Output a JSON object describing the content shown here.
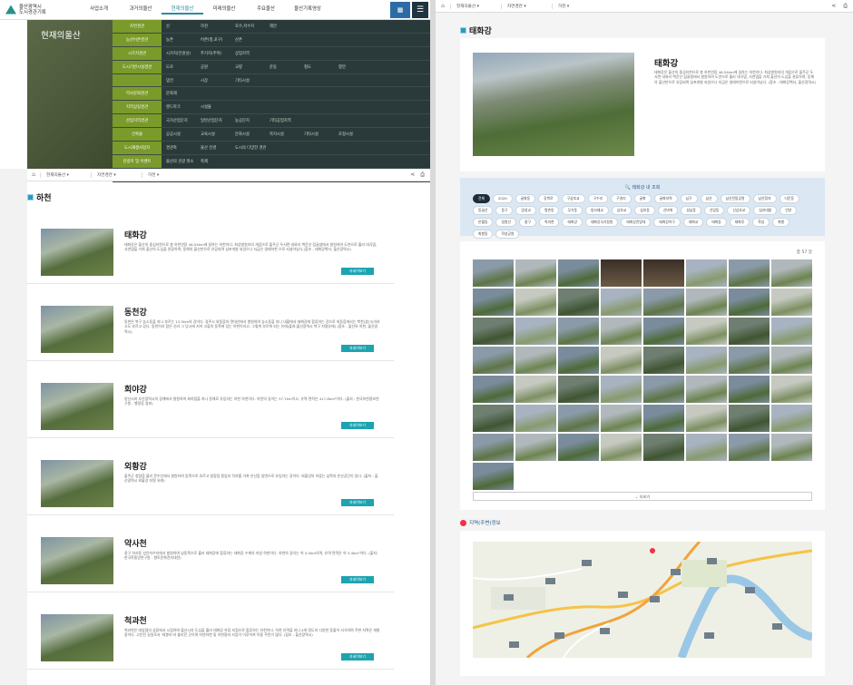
{
  "logo": {
    "line1": "울산광역시",
    "line2": "도시경관기록"
  },
  "nav": [
    "사업소개",
    "과거의울산",
    "현재의울산",
    "미래의울산",
    "주요울산",
    "울산기록영상"
  ],
  "nav_active": "현재의울산",
  "header_button": "meta icon",
  "mega": {
    "brand": "현재의울산",
    "rows": [
      {
        "cat": "자연경관",
        "items": [
          "산",
          "하천",
          "호수,저수지",
          "해안"
        ]
      },
      {
        "cat": "농산어촌경관",
        "items": [
          "농촌",
          "어촌(항,포구)",
          "산촌"
        ]
      },
      {
        "cat": "시가지경관",
        "items": [
          "시가지(전원성)",
          "주거지(주택)",
          "상업지역"
        ]
      },
      {
        "cat": "도시기반시설경관",
        "items": [
          "도로",
          "공원",
          "교량",
          "운동",
          "철도",
          "항만"
        ]
      },
      {
        "cat": "",
        "items": [
          "댐전",
          "시장",
          "기타시설"
        ]
      },
      {
        "cat": "역사문화경관",
        "items": [
          "문화재"
        ]
      },
      {
        "cat": "지역상징경관",
        "items": [
          "랜드마크",
          "시설물"
        ]
      },
      {
        "cat": "산업지역경관",
        "items": [
          "국가산업단지",
          "일반산업단지",
          "농공단지",
          "기타공업지역"
        ]
      },
      {
        "cat": "건축물",
        "items": [
          "공공시설",
          "교육시설",
          "문화시설",
          "복지시설",
          "기타시설",
          "조형시설"
        ]
      },
      {
        "cat": "도시재생사업지",
        "items": [
          "경관축",
          "울산 전경",
          "도시의 다양한 경관"
        ]
      },
      {
        "cat": "관광지 및 이벤트",
        "items": [
          "울산의 관광 명소",
          "축제"
        ]
      },
      {
        "cat": "라이프 변화",
        "items": [
          "사계절의 변화",
          "일출",
          "일몰",
          "동화",
          "야경"
        ]
      }
    ]
  },
  "breadcrumb": [
    "현재의울산",
    "자연경관",
    "하천"
  ],
  "section_title": "하천",
  "more_label": "자세히보기",
  "rivers": [
    {
      "name": "태화강",
      "desc": "태화강은 울산의 중심하천으로 총 하천연장 46.54km에 달하는 하천이다. 최상발원지의 개념으로 울주군 두서면 내와리 백운산 탑골샘에서 발원하여 도연으로 흘러 대곡댐, 사연댐을 거쳐 울산의 도심을 관류하며, 동해의 울산만으로 유입되며 삼포개발 되었으나 지금은 생태하천 으로 되살아났다.(참조 - 태화강백서, 울산광역시)"
    },
    {
      "name": "동천강",
      "desc": "동천은 북구 농소동을 지나 흐르는 13.5km의 강이다. 경주시 외동읍의 면대산에서 발원하여 농소동을 지나 내황에서 태화강에 합류하는 강으로 외동읍에서는 북천(北川)이라고도 부르고 있다. 동천이라 함은 신라 그 당시에 지어 고을의 동쪽에 있는 하천이라고, 그렇게 부르게 되는 유래(출처:울산광역시 북구 지명유래) (참조 - 울산의 하천, 울산광역시)"
    },
    {
      "name": "회야강",
      "desc": "양산시와 부산광역시의 경계에서 발원하여 회야댐을 지나 동해로 유입하는 하천 하천이다. 하천의 길이는 37.7km이고, 유역 면적은 417.8km²이다. (출처 : 한국하천정보연구원 - 행정동 정보)"
    },
    {
      "name": "외황강",
      "desc": "울주군 청량읍 율리 문수산에서 발원하여 동쪽으로 흐르고 청량읍 용암리 덕하를 거쳐 온산읍 방면으로 유입하는 강이다. 외황강의 하류는 남쪽의 온산공단이 있다. (출처 : 울산광역시 외황강 지명 유래)"
    },
    {
      "name": "약사천",
      "desc": "중구 약사동 성안저수지에서 발원하여 남동쪽으로 흘러 태화강에 합류하는 태화강 수계의 지방 하천이다. 하천의 길이는 약 4.5km이며, 유역 면적은 약 3.4km²이다. (출처: 한국학중앙연구원 - 향토문화전자대전)"
    },
    {
      "name": "척과천",
      "desc": "척과천은 대암댐의 상류에서 시점하여 울산시의 도심을 흘러 태화강 하류 지점으로 합류하는 하천이다. 하천 유역을 지나 4개 정도의 다양한 동물이 서식하며 주변 지역은 개발 중이다. 고인된 길일로서 '대봉리'라 불리던 곳이며 자연하천 및 하천정비 사업이 이루어져 이용 주민이 많다. (참조 - 울산광역시)"
    }
  ],
  "detail": {
    "title": "태화강",
    "name": "태화강",
    "desc": "태화강은 울산의 중심하천으로 총 하천연장 46.54km에 달하는 하천이다. 최상발원지의 개념으로 울주군 두서면 내와리 백운산 탑골샘에서 발원하여 도연으로 흘러 대곡댐, 사연댐을 거쳐 울산의 도심을 관류하며, 동해의 울산만으로 유입되며 삼포개발 되었으나 지금은 생태하천으로 되살아났다. (참조 - 태화강백서, 울산광역시)",
    "tag_title": "태화강 내 조회",
    "tags": [
      "전체",
      "2020",
      "굴화동",
      "강북로",
      "구삼호교",
      "구수리",
      "구영리",
      "굴화",
      "굴화지역",
      "남구",
      "남산",
      "남산전망공원",
      "남산정자",
      "다운동",
      "동굴산",
      "동구",
      "망성교",
      "명촌동",
      "무거동",
      "방사제교",
      "삼호교",
      "삼호동",
      "선바위",
      "성남동",
      "선암동",
      "신삼호교",
      "십리대밭",
      "언양",
      "온월동",
      "일원산",
      "중구",
      "척과천",
      "태화강",
      "태화강국가정원",
      "태화강전망대",
      "태화강하구",
      "태화교",
      "태화동",
      "태화루",
      "학성",
      "화봉",
      "화봉동",
      "학성공원"
    ],
    "count": "총 57 장",
    "more": "더보기",
    "map_title": "지역(주변)정보"
  },
  "colors": {
    "accent": "#1ea3b0",
    "nav_active": "#2c8c9c",
    "mega_cat": "#7a9a2a",
    "tag_bg": "#dbe8f3"
  }
}
